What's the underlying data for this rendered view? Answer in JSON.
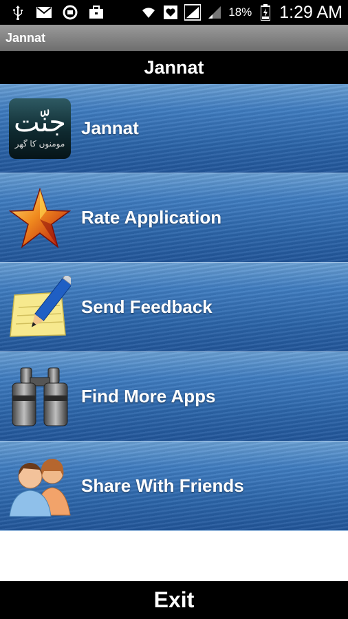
{
  "status_bar": {
    "battery_percent": "18%",
    "time": "1:29 AM",
    "left_icons": [
      "usb-icon",
      "email-icon",
      "sync-icon",
      "briefcase-icon"
    ],
    "right_icons": [
      "wifi-icon",
      "heart-icon",
      "signal-icon",
      "signal-icon",
      "battery-icon"
    ]
  },
  "app_title": "Jannat",
  "header": {
    "title": "Jannat"
  },
  "menu": {
    "items": [
      {
        "label": "Jannat",
        "icon": "app-logo-icon",
        "logo_big": "جنّت",
        "logo_small": "مومنوں کا گھر"
      },
      {
        "label": "Rate Application",
        "icon": "star-icon"
      },
      {
        "label": "Send Feedback",
        "icon": "notepad-pencil-icon"
      },
      {
        "label": "Find More Apps",
        "icon": "binoculars-icon"
      },
      {
        "label": "Share With Friends",
        "icon": "people-icon"
      }
    ]
  },
  "exit": {
    "label": "Exit"
  },
  "colors": {
    "bar_black": "#000000",
    "menu_blue": "#2b64a8",
    "title_gray": "#7f7f7f"
  }
}
